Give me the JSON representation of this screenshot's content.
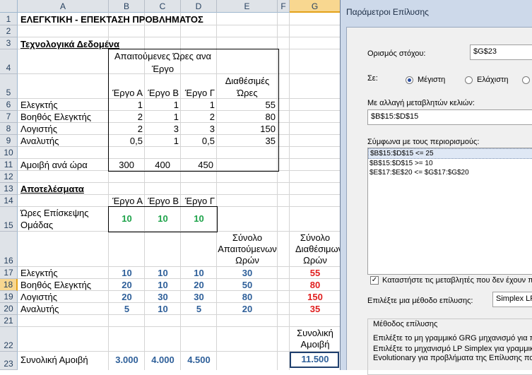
{
  "spreadsheet": {
    "columns": [
      "A",
      "B",
      "C",
      "D",
      "E",
      "F",
      "G"
    ],
    "rows": [
      "1",
      "2",
      "3",
      "4",
      "5",
      "6",
      "7",
      "8",
      "9",
      "10",
      "11",
      "12",
      "13",
      "14",
      "15",
      "16",
      "17",
      "18",
      "19",
      "20",
      "21",
      "22",
      "23"
    ],
    "title": "ΕΛΕΓΚΤΙΚΗ - ΕΠΕΚΤΑΣΗ ΠΡΟΒΛΗΜΑΤΟΣ",
    "tech_title": "Τεχνολογικά Δεδομένα",
    "hours_header_1": "Απαιτούμενες Ώρες ανα",
    "hours_header_2": "Έργο",
    "avail_header_1": "Διαθέσιμές",
    "avail_header_2": "Ώρες",
    "projects": [
      "Έργο Α",
      "Έργο Β",
      "Έργο Γ"
    ],
    "tech_rows": [
      {
        "label": "Ελεγκτής",
        "a": "1",
        "b": "1",
        "c": "1",
        "avail": "55"
      },
      {
        "label": "Βοηθός Ελεγκτής",
        "a": "2",
        "b": "1",
        "c": "2",
        "avail": "80"
      },
      {
        "label": "Λογιστής",
        "a": "2",
        "b": "3",
        "c": "3",
        "avail": "150"
      },
      {
        "label": "Αναλυτής",
        "a": "0,5",
        "b": "1",
        "c": "0,5",
        "avail": "35"
      }
    ],
    "fee_label": "Αμοιβή ανά ώρα",
    "fees": [
      "300",
      "400",
      "450"
    ],
    "results_title": "Αποτελέσματα",
    "visit_label_1": "Ώρες Επίσκεψης",
    "visit_label_2": "Ομάδας",
    "visit_values": [
      "10",
      "10",
      "10"
    ],
    "req_header": [
      "Σύνολο",
      "Απαιτούμενων",
      "Ωρών"
    ],
    "avail_total_header": [
      "Σύνολο",
      "Διαθέσιμων",
      "Ωρών"
    ],
    "result_rows": [
      {
        "label": "Ελεγκτής",
        "a": "10",
        "b": "10",
        "c": "10",
        "req": "30",
        "avail": "55"
      },
      {
        "label": "Βοηθός Ελεγκτής",
        "a": "20",
        "b": "10",
        "c": "20",
        "req": "50",
        "avail": "80"
      },
      {
        "label": "Λογιστής",
        "a": "20",
        "b": "30",
        "c": "30",
        "req": "80",
        "avail": "150"
      },
      {
        "label": "Αναλυτής",
        "a": "5",
        "b": "10",
        "c": "5",
        "req": "20",
        "avail": "35"
      }
    ],
    "total_fee_header": [
      "Συνολική",
      "Αμοιβή"
    ],
    "total_fee_label": "Συνολική Αμοιβή",
    "total_fees": [
      "3.000",
      "4.000",
      "4.500"
    ],
    "grand_total": "11.500"
  },
  "solver": {
    "window_title": "Παράμετροι Επίλυσης",
    "objective_label": "Ορισμός στόχου:",
    "objective_value": "$G$23",
    "to_label": "Σε:",
    "max_label": "Μέγιστη",
    "min_label": "Ελάχιστη",
    "value_label_partial": "Τ",
    "changing_label": "Με αλλαγή μεταβλητών κελιών:",
    "changing_value": "$B$15:$D$15",
    "constraints_label": "Σύμφωνα με τους περιορισμούς:",
    "constraints": [
      "$B$15:$D$15 <= 25",
      "$B$15:$D$15 >= 10",
      "$E$17:$E$20 <= $G$17:$G$20"
    ],
    "nonneg_label": "Καταστήστε τις μεταβλητές που δεν έχουν πε",
    "method_label": "Επιλέξτε μια μέθοδο επίλυσης:",
    "method_value": "Simplex LP",
    "method_group": "Μέθοδος επίλυσης",
    "method_desc": [
      "Επιλέξτε το μη γραμμικό GRG μηχανισμό για πρ",
      "Επιλέξτε το μηχανισμό LP Simplex για γραμμικά",
      "Evolutionary για προβλήματα της Επίλυσης που"
    ]
  }
}
